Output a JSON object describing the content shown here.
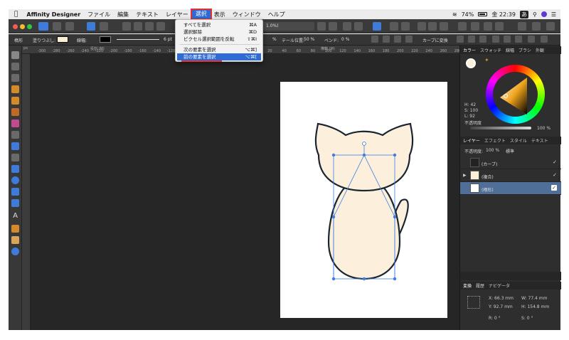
{
  "menubar": {
    "app_name": "Affinity Designer",
    "items": [
      "ファイル",
      "編集",
      "テキスト",
      "レイヤー",
      "選択",
      "表示",
      "ウィンドウ",
      "ヘルプ"
    ],
    "selected": "選択",
    "battery": "74%",
    "clock": "金 22:39",
    "input_source": "あ"
  },
  "toolbar": {
    "zoom_text": "1.0%)"
  },
  "context_bar": {
    "shape_label": "楕形",
    "fill_label": "塗りつぶし:",
    "stroke_label": "線幅:",
    "stroke_value": "6 pt",
    "percent_a": "%",
    "tail_label": "テール位置:",
    "tail_value": "50 %",
    "bend_label": "ベンド:",
    "bend_value": "0 %",
    "convert_label": "カーブに変換",
    "accent_color": "#fcefd8"
  },
  "select_menu": {
    "items": [
      {
        "label": "すべてを選択",
        "shortcut": "⌘A"
      },
      {
        "label": "選択解除",
        "shortcut": "⌘D"
      },
      {
        "label": "ピクセル選択範囲を反転",
        "shortcut": "⇧⌘I"
      },
      {
        "label": "次の要素を選択",
        "shortcut": "⌥⌘]"
      },
      {
        "label": "前の要素を選択",
        "shortcut": "⌥⌘["
      }
    ],
    "highlighted": "前の要素を選択",
    "highlight_color": "#2f6bd4"
  },
  "rulers": {
    "unit": "px",
    "top_title_left": "役割 (M)",
    "top_title_right": "横軸 (M)",
    "ticks": [
      "-300",
      "-280",
      "-260",
      "-240",
      "-220",
      "-200",
      "-180",
      "-160",
      "-140",
      "-120",
      "-100",
      "-80",
      "-60",
      "-40",
      "-20",
      "0",
      "20",
      "40",
      "60",
      "80",
      "100",
      "120",
      "140",
      "160",
      "180",
      "200",
      "220",
      "240",
      "260",
      "280"
    ]
  },
  "artwork": {
    "fill_color": "#fcf0dc",
    "stroke_color": "#1b2433",
    "selection_color": "#3b7fe0"
  },
  "panel": {
    "color_tabs": [
      "カラー",
      "スウォッチ",
      "線幅",
      "ブラシ",
      "外観"
    ],
    "hsl": {
      "h": "H: 42",
      "s": "S: 100",
      "l": "L: 92"
    },
    "opacity_label": "不透明度",
    "opacity_value": "100 %",
    "layer_tabs": [
      "レイヤー",
      "エフェクト",
      "スタイル",
      "テキスト"
    ],
    "layer_opacity_label": "不透明度:",
    "layer_opacity_value": "100 %",
    "blend_mode": "標準",
    "layers": [
      {
        "name": "(カーブ)",
        "visible": true,
        "selected": false
      },
      {
        "name": "(複合)",
        "visible": true,
        "selected": false
      },
      {
        "name": "(楕形)",
        "visible": true,
        "selected": true
      }
    ],
    "transform_tabs": [
      "変換",
      "履歴",
      "ナビゲータ"
    ],
    "transform": {
      "x": "X: 66.3 mm",
      "w": "W: 77.4 mm",
      "y": "Y: 92.7 mm",
      "h": "H: 154.8 mm",
      "r": "R: 0 °",
      "s": "S: 0 °"
    }
  }
}
